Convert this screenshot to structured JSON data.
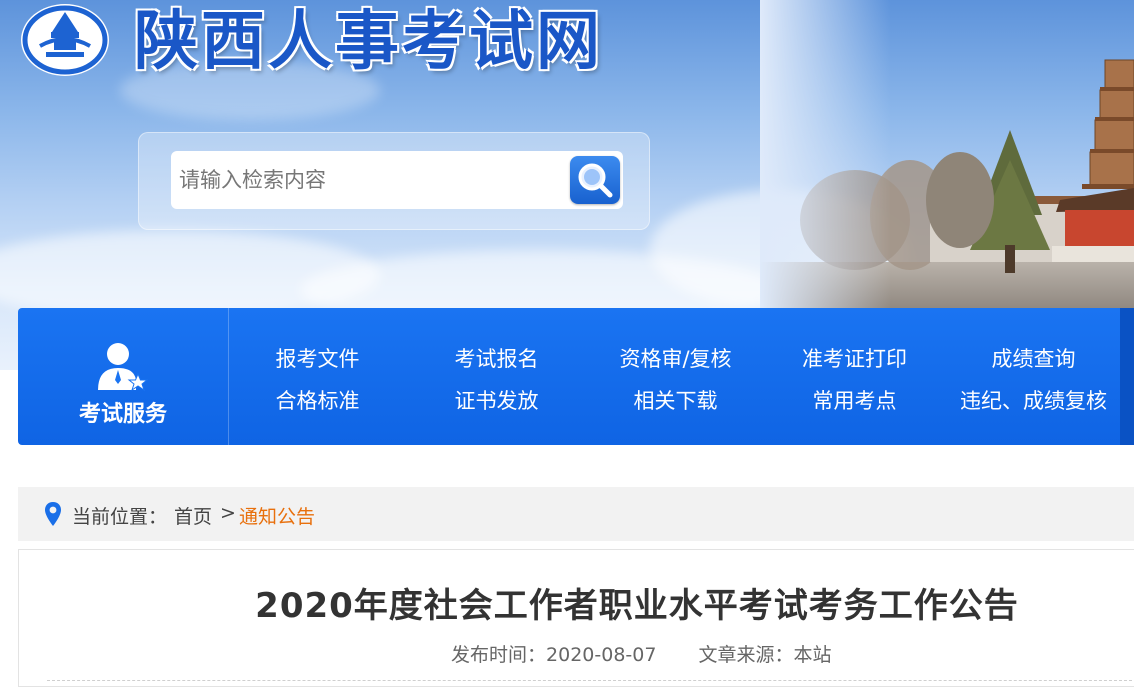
{
  "header": {
    "site_title": "陕西人事考试网",
    "logo": "emblem-logo"
  },
  "search": {
    "placeholder": "请输入检索内容",
    "button_icon": "magnifier-icon"
  },
  "nav": {
    "service_label": "考试服务",
    "service_icon": "person-star-icon",
    "row1": [
      "报考文件",
      "考试报名",
      "资格审/复核",
      "准考证打印",
      "成绩查询"
    ],
    "row2": [
      "合格标准",
      "证书发放",
      "相关下载",
      "常用考点",
      "违纪、成绩复核"
    ]
  },
  "breadcrumb": {
    "prefix": "当前位置：",
    "home": "首页",
    "separator": ">",
    "current": "通知公告",
    "icon": "location-pin-icon"
  },
  "article": {
    "title": "2020年度社会工作者职业水平考试考务工作公告",
    "publish_label": "发布时间：",
    "publish_date": "2020-08-07",
    "source_label": "文章来源：",
    "source": "本站"
  },
  "colors": {
    "brand_blue": "#1a74f2",
    "title_blue": "#1a57c7",
    "breadcrumb_active": "#e8700d"
  }
}
